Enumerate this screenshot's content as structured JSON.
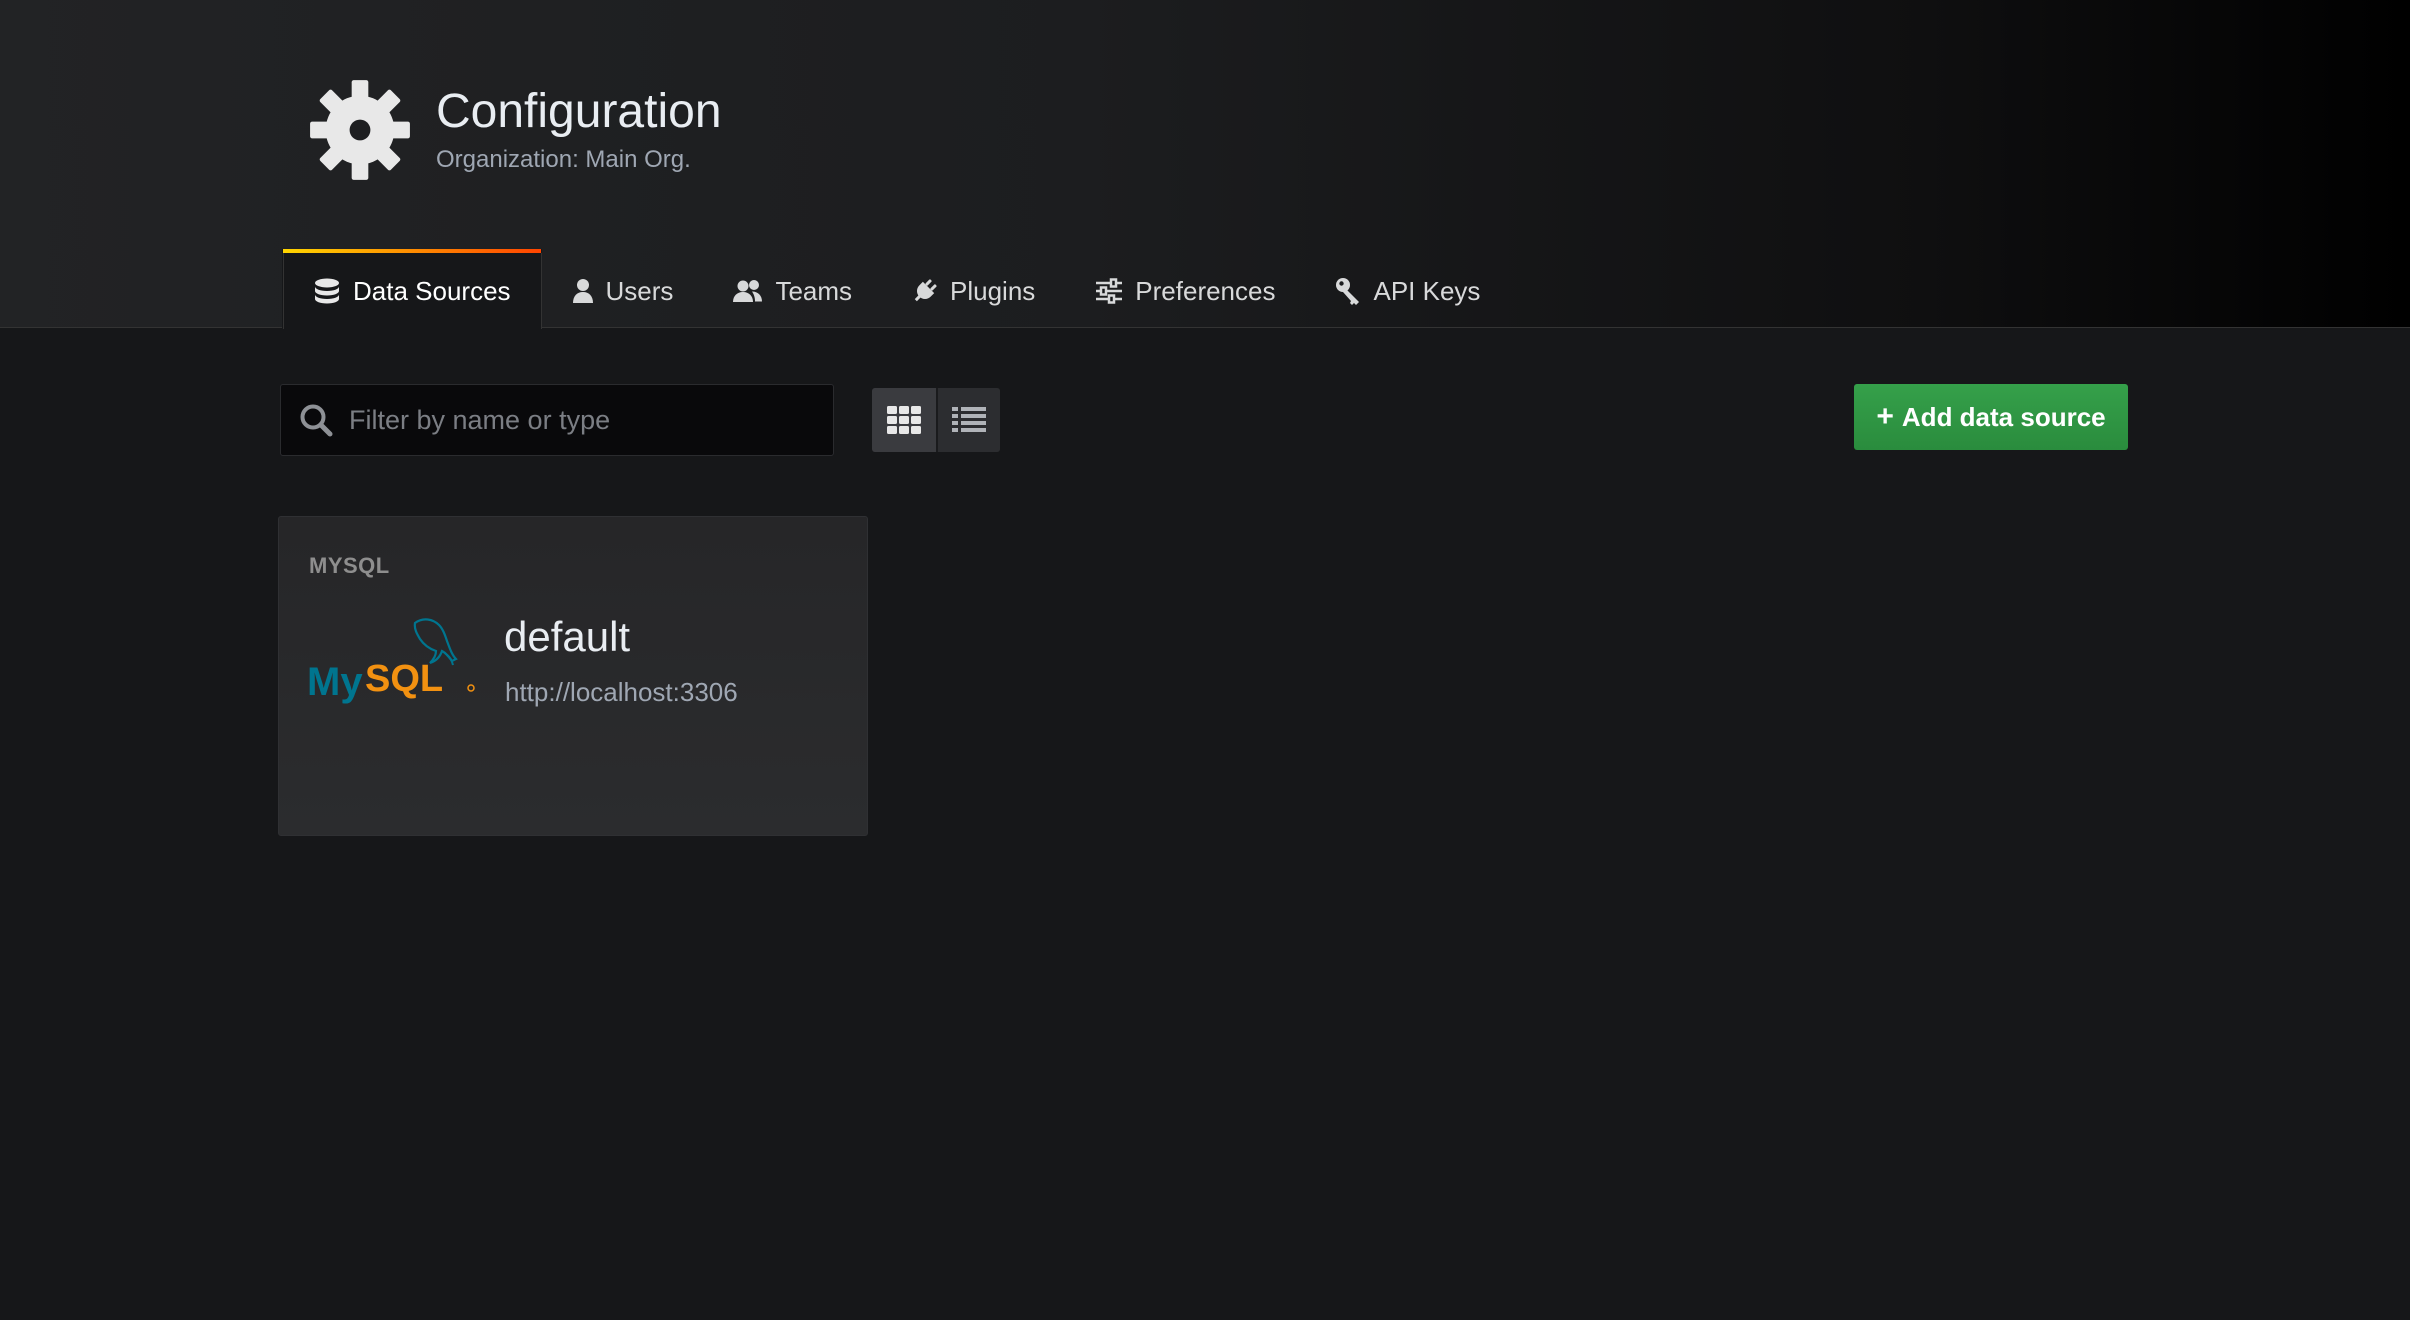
{
  "header": {
    "title": "Configuration",
    "subtitle": "Organization: Main Org.",
    "icon": "gear-icon"
  },
  "tabs": [
    {
      "label": "Data Sources",
      "icon": "database-icon",
      "active": true
    },
    {
      "label": "Users",
      "icon": "user-icon",
      "active": false
    },
    {
      "label": "Teams",
      "icon": "users-icon",
      "active": false
    },
    {
      "label": "Plugins",
      "icon": "plug-icon",
      "active": false
    },
    {
      "label": "Preferences",
      "icon": "sliders-icon",
      "active": false
    },
    {
      "label": "API Keys",
      "icon": "key-icon",
      "active": false
    }
  ],
  "toolbar": {
    "search_placeholder": "Filter by name or type",
    "search_value": "",
    "view_mode": "grid",
    "add_label": "Add data source",
    "add_icon": "plus-icon"
  },
  "datasources": [
    {
      "type": "MYSQL",
      "name": "default",
      "url": "http://localhost:3306",
      "logo": "mysql-logo"
    }
  ],
  "colors": {
    "background": "#161719",
    "accent_gradient_start": "#ffd500",
    "accent_gradient_end": "#ff4400",
    "primary_button": "#2f9741",
    "mysql_blue": "#00758f",
    "mysql_orange": "#f29111"
  }
}
